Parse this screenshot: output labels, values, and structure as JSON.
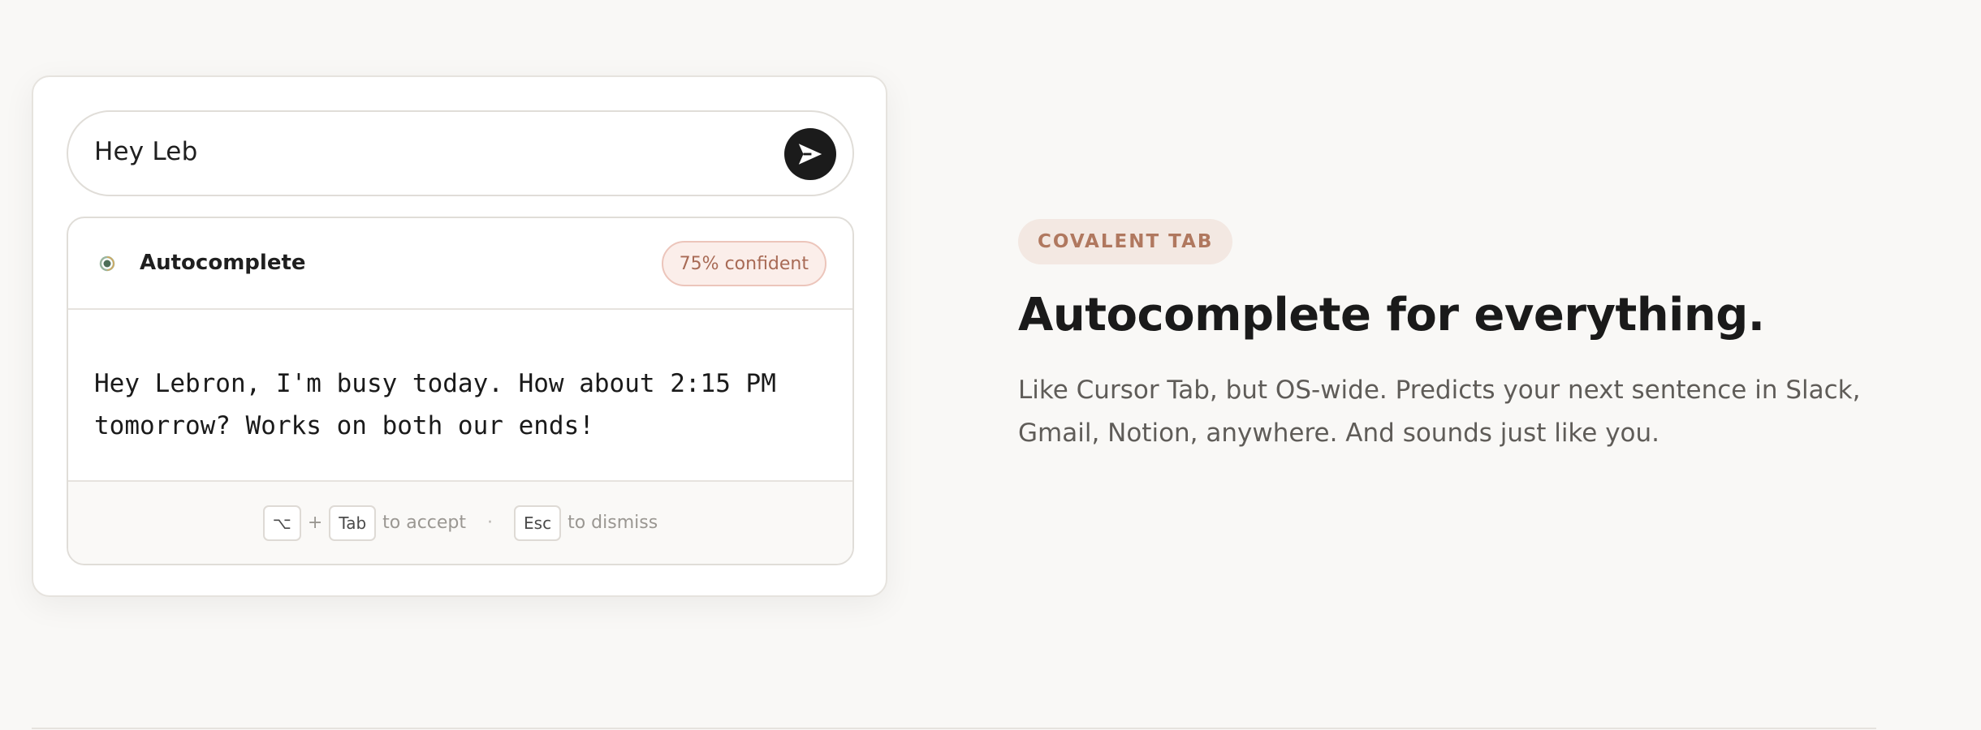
{
  "composer": {
    "input_value": "Hey Leb",
    "send_icon": "send-icon"
  },
  "suggestion": {
    "logo_icon": "covalent-logo-icon",
    "title": "Autocomplete",
    "confidence": "75% confident",
    "text": "Hey Lebron, I'm busy today. How about 2:15 PM tomorrow? Works on both our ends!",
    "footer": {
      "key_option": "⌥",
      "plus": "+",
      "key_tab": "Tab",
      "accept_label": "to accept",
      "separator": "·",
      "key_esc": "Esc",
      "dismiss_label": "to dismiss"
    }
  },
  "feature": {
    "tag": "COVALENT TAB",
    "headline": "Autocomplete for everything.",
    "description": "Like Cursor Tab, but OS-wide. Predicts your next sentence in Slack, Gmail, Notion, anywhere. And sounds just like you."
  },
  "colors": {
    "background": "#f9f8f6",
    "accent": "#b0785f",
    "badge_bg": "#fbeeea",
    "send_button": "#1b1b1b"
  }
}
